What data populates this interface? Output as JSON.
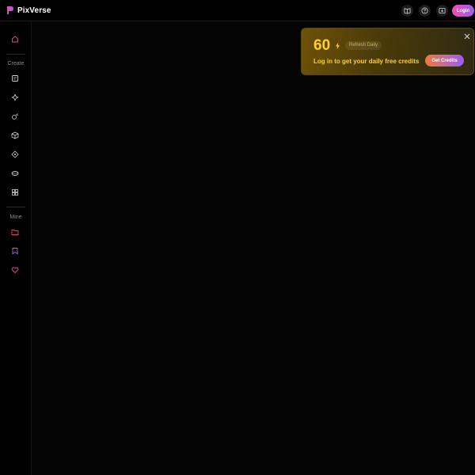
{
  "header": {
    "brand": "PixVerse",
    "login_label": "Login",
    "icons": [
      "book-icon",
      "help-icon",
      "download-icon"
    ]
  },
  "sidebar": {
    "home_icon": "home-icon",
    "create_label": "Create",
    "create_items": [
      "text-image-icon",
      "sparkle-icon",
      "magic-wand-icon",
      "cube-icon",
      "diamond-icon",
      "ring-icon",
      "grid-icon"
    ],
    "mine_label": "Mine",
    "mine_items": [
      "folder-icon",
      "bookmark-icon",
      "heart-icon"
    ]
  },
  "popup": {
    "credits": "60",
    "refresh_label": "Refresh Daily",
    "message": "Log in to get your daily free credits",
    "button_label": "Get Credits"
  },
  "colors": {
    "accent_gold": "#ffcf2d",
    "gradient_pink": "#f04fa8",
    "gradient_purple": "#9b5cf5"
  }
}
